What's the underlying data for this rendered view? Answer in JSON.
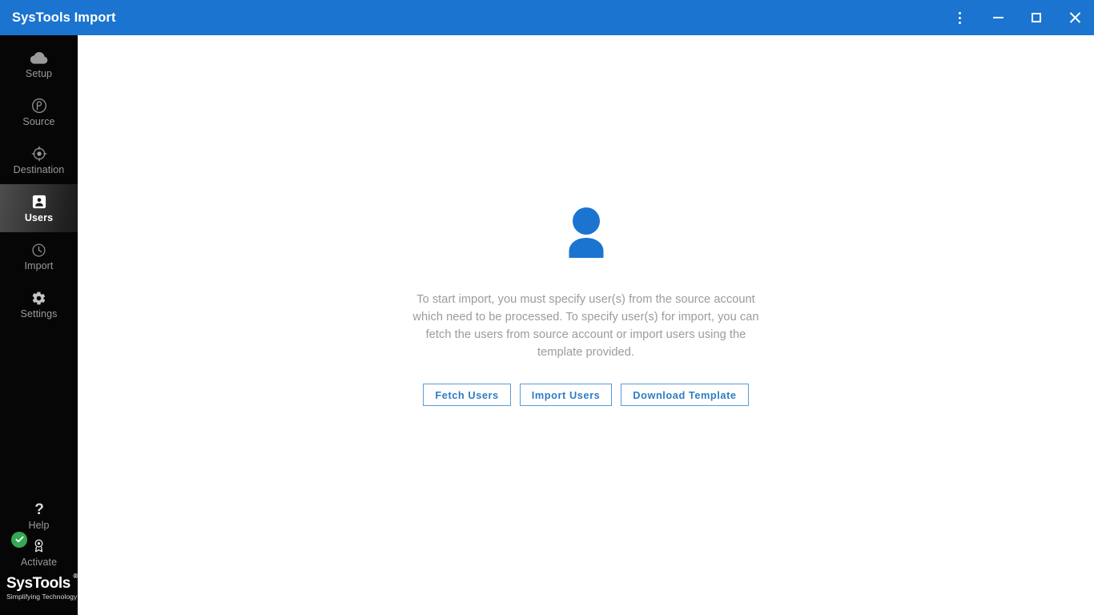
{
  "window": {
    "title": "SysTools Import",
    "accent_color": "#1b74cf",
    "controls": {
      "menu": "⋮",
      "menu_name": "More options",
      "minimize": "Minimize",
      "maximize": "Maximize",
      "close": "Close"
    }
  },
  "sidebar": {
    "background_color": "#060606",
    "items": [
      {
        "label": "Setup",
        "icon": "cloud-icon",
        "active": false
      },
      {
        "label": "Source",
        "icon": "source-icon",
        "active": false
      },
      {
        "label": "Destination",
        "icon": "target-icon",
        "active": false
      },
      {
        "label": "Users",
        "icon": "contact-card-icon",
        "active": true
      },
      {
        "label": "Import",
        "icon": "clock-icon",
        "active": false
      },
      {
        "label": "Settings",
        "icon": "gear-icon",
        "active": false
      }
    ],
    "bottom_items": [
      {
        "label": "Help",
        "icon": "question-mark-icon"
      },
      {
        "label": "Activate",
        "icon": "award-icon",
        "badge": "check",
        "badge_color": "#34a853"
      }
    ],
    "brand": {
      "name": "SysTools",
      "registered": "®",
      "tagline": "Simplifying Technology"
    }
  },
  "main": {
    "illustration": "person-icon",
    "illustration_color": "#1b74cf",
    "description": "To start import, you must specify user(s) from the source account which need to be processed. To specify user(s) for import, you can fetch the users from source account or import users using the template provided.",
    "buttons": [
      {
        "label": "Fetch Users"
      },
      {
        "label": "Import Users"
      },
      {
        "label": "Download Template"
      }
    ]
  }
}
